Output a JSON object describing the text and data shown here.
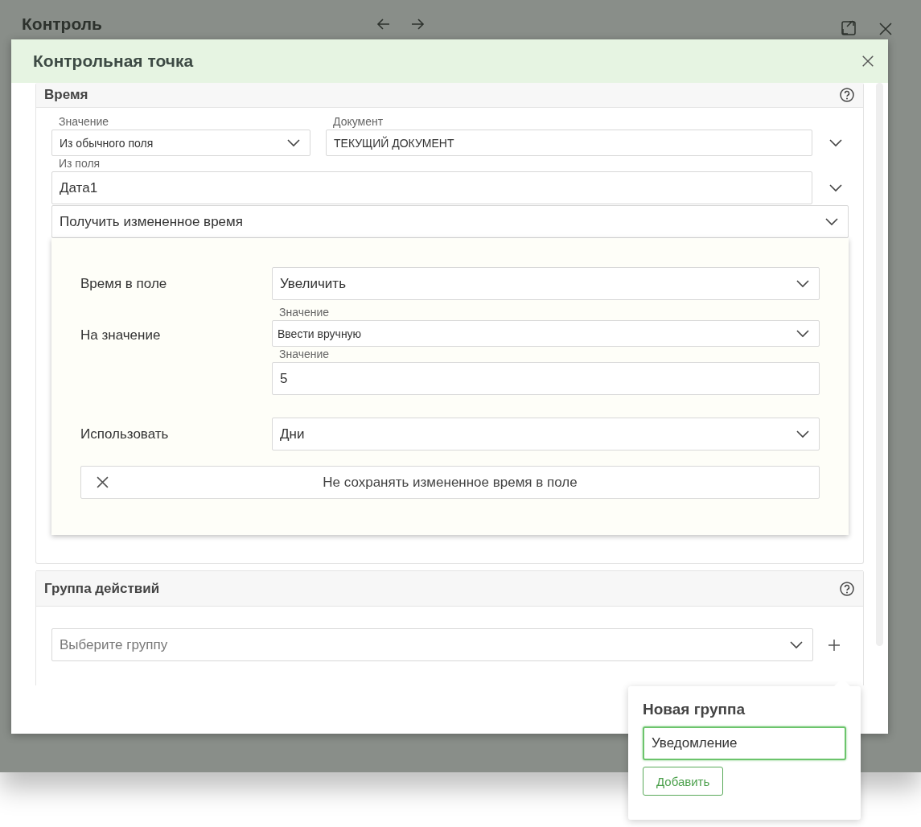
{
  "background_window": {
    "title": "Контроль"
  },
  "dialog": {
    "title": "Контрольная точка"
  },
  "time_section": {
    "title": "Время",
    "value_label": "Значение",
    "value_select": "Из обычного поля",
    "document_label": "Документ",
    "document_value": "ТЕКУЩИЙ ДОКУМЕНТ",
    "from_field_label": "Из поля",
    "from_field_value": "Дата1",
    "mode_select": "Получить измененное время",
    "expanded": true,
    "panel": {
      "time_in_field": {
        "label": "Время в поле",
        "value": "Увеличить"
      },
      "on_value": {
        "label": "На значение",
        "source_label": "Значение",
        "source_value": "Ввести вручную",
        "value_label": "Значение",
        "value": "5"
      },
      "use": {
        "label": "Использовать",
        "value": "Дни"
      },
      "no_save_button": "Не сохранять измененное время в поле"
    }
  },
  "actions_section": {
    "title": "Группа действий",
    "group_placeholder": "Выберите группу"
  },
  "new_group_popover": {
    "title": "Новая группа",
    "value": "Уведомление",
    "add_button": "Добавить"
  }
}
